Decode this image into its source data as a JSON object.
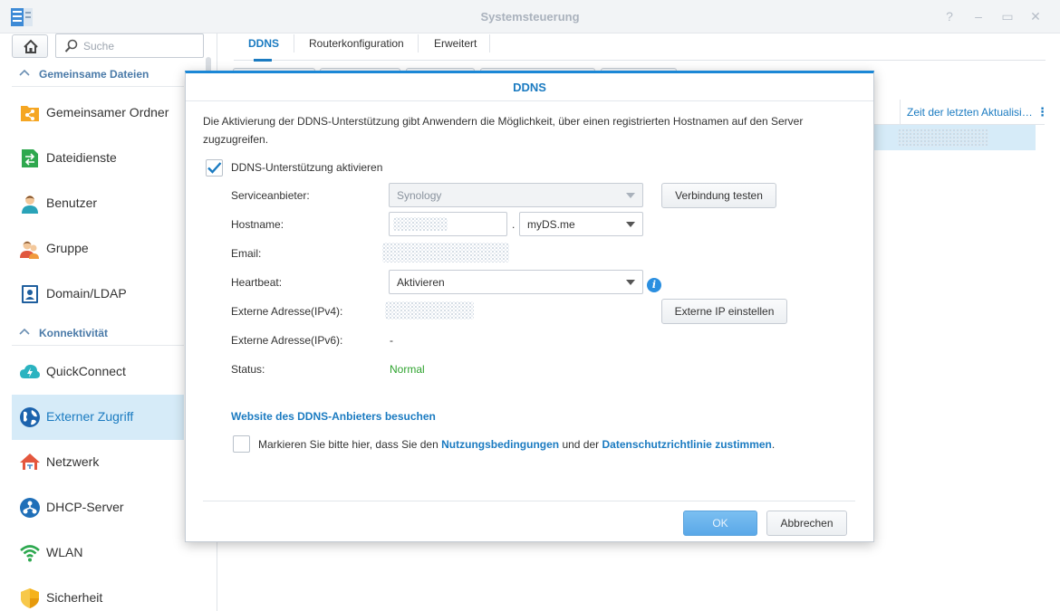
{
  "window": {
    "title": "Systemsteuerung"
  },
  "sidebar": {
    "search_placeholder": "Suche",
    "groups": [
      {
        "label": "Gemeinsame Dateien"
      },
      {
        "label": "Konnektivität"
      }
    ],
    "items": [
      {
        "label": "Gemeinsamer Ordner",
        "icon": "shared-folder-icon"
      },
      {
        "label": "Dateidienste",
        "icon": "file-services-icon"
      },
      {
        "label": "Benutzer",
        "icon": "user-icon"
      },
      {
        "label": "Gruppe",
        "icon": "group-icon"
      },
      {
        "label": "Domain/LDAP",
        "icon": "domain-icon"
      },
      {
        "label": "QuickConnect",
        "icon": "quickconnect-icon"
      },
      {
        "label": "Externer Zugriff",
        "icon": "globe-icon",
        "active": true
      },
      {
        "label": "Netzwerk",
        "icon": "network-icon"
      },
      {
        "label": "DHCP-Server",
        "icon": "dhcp-icon"
      },
      {
        "label": "WLAN",
        "icon": "wifi-icon"
      },
      {
        "label": "Sicherheit",
        "icon": "shield-icon"
      }
    ]
  },
  "main": {
    "tabs": [
      {
        "label": "DDNS",
        "active": true
      },
      {
        "label": "Routerkonfiguration"
      },
      {
        "label": "Erweitert"
      }
    ],
    "grid": {
      "last_update_header": "Zeit der letzten Aktualisi…"
    }
  },
  "dialog": {
    "title": "DDNS",
    "description": "Die Aktivierung der DDNS-Unterstützung gibt Anwendern die Möglichkeit, über einen registrierten Hostnamen auf den Server zugzugreifen.",
    "enable_label": "DDNS-Unterstützung aktivieren",
    "enable_checked": true,
    "provider": {
      "label": "Serviceanbieter:",
      "value": "Synology",
      "test_button": "Verbindung testen"
    },
    "hostname": {
      "label": "Hostname:",
      "dot": ".",
      "domain": "myDS.me"
    },
    "email": {
      "label": "Email:"
    },
    "heartbeat": {
      "label": "Heartbeat:",
      "value": "Aktivieren"
    },
    "ipv4": {
      "label": "Externe Adresse(IPv4):",
      "button": "Externe IP einstellen"
    },
    "ipv6": {
      "label": "Externe Adresse(IPv6):",
      "value": "-"
    },
    "status": {
      "label": "Status:",
      "value": "Normal"
    },
    "provider_link": "Website des DDNS-Anbieters besuchen",
    "agree": {
      "prefix": "Markieren Sie bitte hier, dass Sie den",
      "terms": "Nutzungsbedingungen",
      "middle": "und der",
      "privacy": "Datenschutzrichtlinie zustimmen",
      "suffix": "."
    },
    "ok_button": "OK",
    "cancel_button": "Abbrechen"
  },
  "colors": {
    "accent": "#1b7bc1",
    "active_bg": "#d6ebf8",
    "status_ok": "#2ea32e"
  }
}
